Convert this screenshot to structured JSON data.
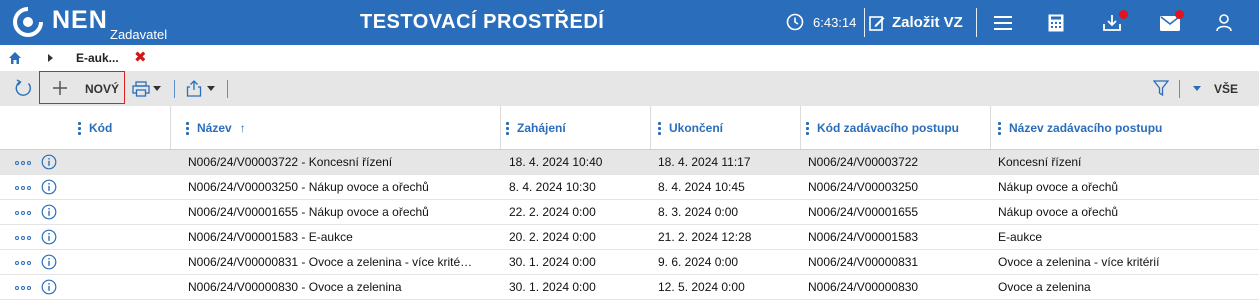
{
  "header": {
    "brand": "NEN",
    "brand_sub": "Zadavatel",
    "env_title": "TESTOVACÍ PROSTŘEDÍ",
    "clock": "6:43:14",
    "create_label": "Založit VZ",
    "icons": [
      "clock-icon",
      "edit-icon",
      "menu-icon",
      "calculator-icon",
      "download-icon",
      "mail-icon",
      "user-icon"
    ],
    "notification_color": "#e0141e",
    "bar_color": "#2a6ebb"
  },
  "breadcrumb": {
    "tab_label": "E-auk...",
    "close_symbol": "✖"
  },
  "toolbar": {
    "new_label": "NOVÝ",
    "filter_scope": "VŠE"
  },
  "table": {
    "columns": [
      {
        "label": "Kód"
      },
      {
        "label": "Název",
        "sort_icon": "↑"
      },
      {
        "label": "Zahájení"
      },
      {
        "label": "Ukončení"
      },
      {
        "label": "Kód zadávacího postupu"
      },
      {
        "label": "Název zadávacího postupu"
      }
    ],
    "rows": [
      {
        "nazev": "N006/24/V00003722 - Koncesní řízení",
        "zahajeni": "18. 4. 2024 10:40",
        "ukonceni": "18. 4. 2024 11:17",
        "kod_postupu": "N006/24/V00003722",
        "nazev_postupu": "Koncesní řízení",
        "selected": true
      },
      {
        "nazev": "N006/24/V00003250 - Nákup ovoce a ořechů",
        "zahajeni": "8. 4. 2024 10:30",
        "ukonceni": "8. 4. 2024 10:45",
        "kod_postupu": "N006/24/V00003250",
        "nazev_postupu": "Nákup ovoce a ořechů"
      },
      {
        "nazev": "N006/24/V00001655 - Nákup ovoce a ořechů",
        "zahajeni": "22. 2. 2024 0:00",
        "ukonceni": "8. 3. 2024 0:00",
        "kod_postupu": "N006/24/V00001655",
        "nazev_postupu": "Nákup ovoce a ořechů"
      },
      {
        "nazev": "N006/24/V00001583 - E-aukce",
        "zahajeni": "20. 2. 2024 0:00",
        "ukonceni": "21. 2. 2024 12:28",
        "kod_postupu": "N006/24/V00001583",
        "nazev_postupu": "E-aukce"
      },
      {
        "nazev": "N006/24/V00000831 - Ovoce a zelenina - více krité…",
        "zahajeni": "30. 1. 2024 0:00",
        "ukonceni": "9. 6. 2024 0:00",
        "kod_postupu": "N006/24/V00000831",
        "nazev_postupu": "Ovoce a zelenina - více kritérií"
      },
      {
        "nazev": "N006/24/V00000830 - Ovoce a zelenina",
        "zahajeni": "30. 1. 2024 0:00",
        "ukonceni": "12. 5. 2024 0:00",
        "kod_postupu": "N006/24/V00000830",
        "nazev_postupu": "Ovoce a zelenina"
      }
    ]
  }
}
